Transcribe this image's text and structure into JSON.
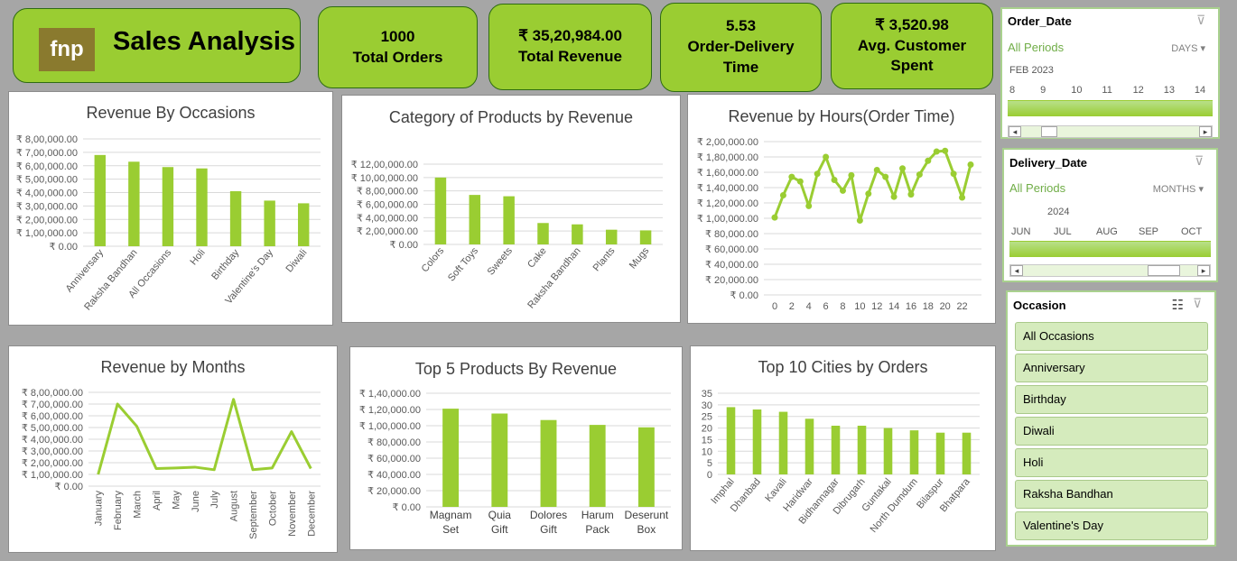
{
  "brand": {
    "logo_text": "fnp",
    "title": "Sales Analysis"
  },
  "kpis": [
    {
      "value": "1000",
      "label": "Total Orders"
    },
    {
      "value": "₹ 35,20,984.00",
      "label": "Total Revenue"
    },
    {
      "value": "5.53",
      "label": "Order-Delivery Time"
    },
    {
      "value": "₹ 3,520.98",
      "label": "Avg. Customer Spent"
    }
  ],
  "colors": {
    "accent": "#9acd32",
    "bar": "#9acd32",
    "grid": "#d9d9d9"
  },
  "chart_data": [
    {
      "type": "bar",
      "title": "Revenue By Occasions",
      "categories": [
        "Anniversary",
        "Raksha Bandhan",
        "All Occasions",
        "Holi",
        "Birthday",
        "Valentine's Day",
        "Diwali"
      ],
      "values": [
        680000,
        630000,
        590000,
        580000,
        410000,
        340000,
        320000
      ],
      "yticks": [
        "₹ 0.00",
        "₹ 1,00,000.00",
        "₹ 2,00,000.00",
        "₹ 3,00,000.00",
        "₹ 4,00,000.00",
        "₹ 5,00,000.00",
        "₹ 6,00,000.00",
        "₹ 7,00,000.00",
        "₹ 8,00,000.00"
      ],
      "ylim": [
        0,
        800000
      ]
    },
    {
      "type": "bar",
      "title": "Category of Products by Revenue",
      "categories": [
        "Colors",
        "Soft Toys",
        "Sweets",
        "Cake",
        "Raksha Bandhan",
        "Plants",
        "Mugs"
      ],
      "values": [
        1000000,
        740000,
        720000,
        320000,
        300000,
        220000,
        210000
      ],
      "yticks": [
        "₹ 0.00",
        "₹ 2,00,000.00",
        "₹ 4,00,000.00",
        "₹ 6,00,000.00",
        "₹ 8,00,000.00",
        "₹ 10,00,000.00",
        "₹ 12,00,000.00"
      ],
      "ylim": [
        0,
        1200000
      ]
    },
    {
      "type": "line",
      "title": "Revenue by Hours(Order Time)",
      "x": [
        0,
        1,
        2,
        3,
        4,
        5,
        6,
        7,
        8,
        9,
        10,
        11,
        12,
        13,
        14,
        15,
        16,
        17,
        18,
        19,
        20,
        21,
        22,
        23
      ],
      "values": [
        101000,
        130000,
        154000,
        148000,
        116000,
        158000,
        180000,
        150000,
        136000,
        156000,
        97000,
        132000,
        163000,
        154000,
        128000,
        165000,
        131000,
        157000,
        175000,
        187000,
        188000,
        158000,
        127000,
        170000
      ],
      "xticks": [
        "0",
        "2",
        "4",
        "6",
        "8",
        "10",
        "12",
        "14",
        "16",
        "18",
        "20",
        "22"
      ],
      "yticks": [
        "₹ 0.00",
        "₹ 20,000.00",
        "₹ 40,000.00",
        "₹ 60,000.00",
        "₹ 80,000.00",
        "₹ 1,00,000.00",
        "₹ 1,20,000.00",
        "₹ 1,40,000.00",
        "₹ 1,60,000.00",
        "₹ 1,80,000.00",
        "₹ 2,00,000.00"
      ],
      "ylim": [
        0,
        200000
      ],
      "markers": true
    },
    {
      "type": "line",
      "title": "Revenue by Months",
      "categories": [
        "January",
        "February",
        "March",
        "April",
        "May",
        "June",
        "July",
        "August",
        "September",
        "October",
        "November",
        "December"
      ],
      "values": [
        100000,
        700000,
        510000,
        150000,
        155000,
        162000,
        140000,
        740000,
        140000,
        155000,
        465000,
        150000
      ],
      "yticks": [
        "₹ 0.00",
        "₹ 1,00,000.00",
        "₹ 2,00,000.00",
        "₹ 3,00,000.00",
        "₹ 4,00,000.00",
        "₹ 5,00,000.00",
        "₹ 6,00,000.00",
        "₹ 7,00,000.00",
        "₹ 8,00,000.00"
      ],
      "ylim": [
        0,
        800000
      ]
    },
    {
      "type": "bar",
      "title": "Top 5 Products By Revenue",
      "categories": [
        "Magnam Set",
        "Quia Gift",
        "Dolores Gift",
        "Harum Pack",
        "Deserunt Box"
      ],
      "values": [
        121000,
        115000,
        107000,
        101000,
        98000
      ],
      "yticks": [
        "₹ 0.00",
        "₹ 20,000.00",
        "₹ 40,000.00",
        "₹ 60,000.00",
        "₹ 80,000.00",
        "₹ 1,00,000.00",
        "₹ 1,20,000.00",
        "₹ 1,40,000.00"
      ],
      "ylim": [
        0,
        140000
      ]
    },
    {
      "type": "bar",
      "title": "Top 10 Cities by Orders",
      "categories": [
        "Imphal",
        "Dhanbad",
        "Kavali",
        "Haridwar",
        "Bidhannagar",
        "Dibrugarh",
        "Guntakal",
        "North Dumdum",
        "Bilaspur",
        "Bhatpara"
      ],
      "values": [
        29,
        28,
        27,
        24,
        21,
        21,
        20,
        19,
        18,
        18
      ],
      "yticks": [
        "0",
        "5",
        "10",
        "15",
        "20",
        "25",
        "30",
        "35"
      ],
      "ylim": [
        0,
        35
      ]
    }
  ],
  "slicers": {
    "order_date": {
      "title": "Order_Date",
      "periods": "All Periods",
      "unit": "DAYS",
      "sub": "FEB 2023",
      "ticks": [
        "8",
        "9",
        "10",
        "11",
        "12",
        "13",
        "14"
      ]
    },
    "delivery_date": {
      "title": "Delivery_Date",
      "periods": "All Periods",
      "unit": "MONTHS",
      "sub": "2024",
      "ticks": [
        "JUN",
        "JUL",
        "AUG",
        "SEP",
        "OCT"
      ]
    },
    "occasion": {
      "title": "Occasion",
      "items": [
        "All Occasions",
        "Anniversary",
        "Birthday",
        "Diwali",
        "Holi",
        "Raksha Bandhan",
        "Valentine's Day"
      ]
    }
  }
}
